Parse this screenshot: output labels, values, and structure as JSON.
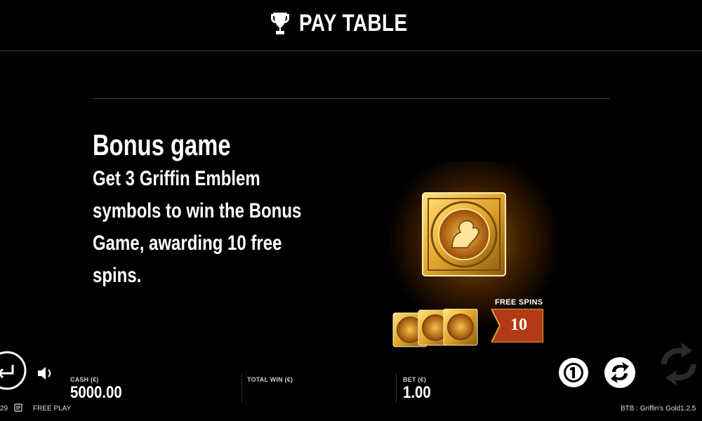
{
  "header": {
    "title": "PAY TABLE",
    "icon": "trophy-icon"
  },
  "section": {
    "title": "Bonus game",
    "description": "Get 3 Griffin Emblem symbols to win the Bonus Game, awarding 10 free spins."
  },
  "feature": {
    "label": "FREE SPINS",
    "value": "10"
  },
  "footer": {
    "cash_label": "CASH (€)",
    "cash_value": "5000.00",
    "total_win_label": "TOTAL WIN (€)",
    "total_win_value": "",
    "bet_label": "BET (€)",
    "bet_value": "1.00",
    "mode": "FREE PLAY",
    "time": "29",
    "game_name": "BTB : Griffin's Gold",
    "version": "1.2.5"
  },
  "colors": {
    "background": "#000000",
    "gold": "#e0a52a",
    "banner": "#b23a14"
  }
}
